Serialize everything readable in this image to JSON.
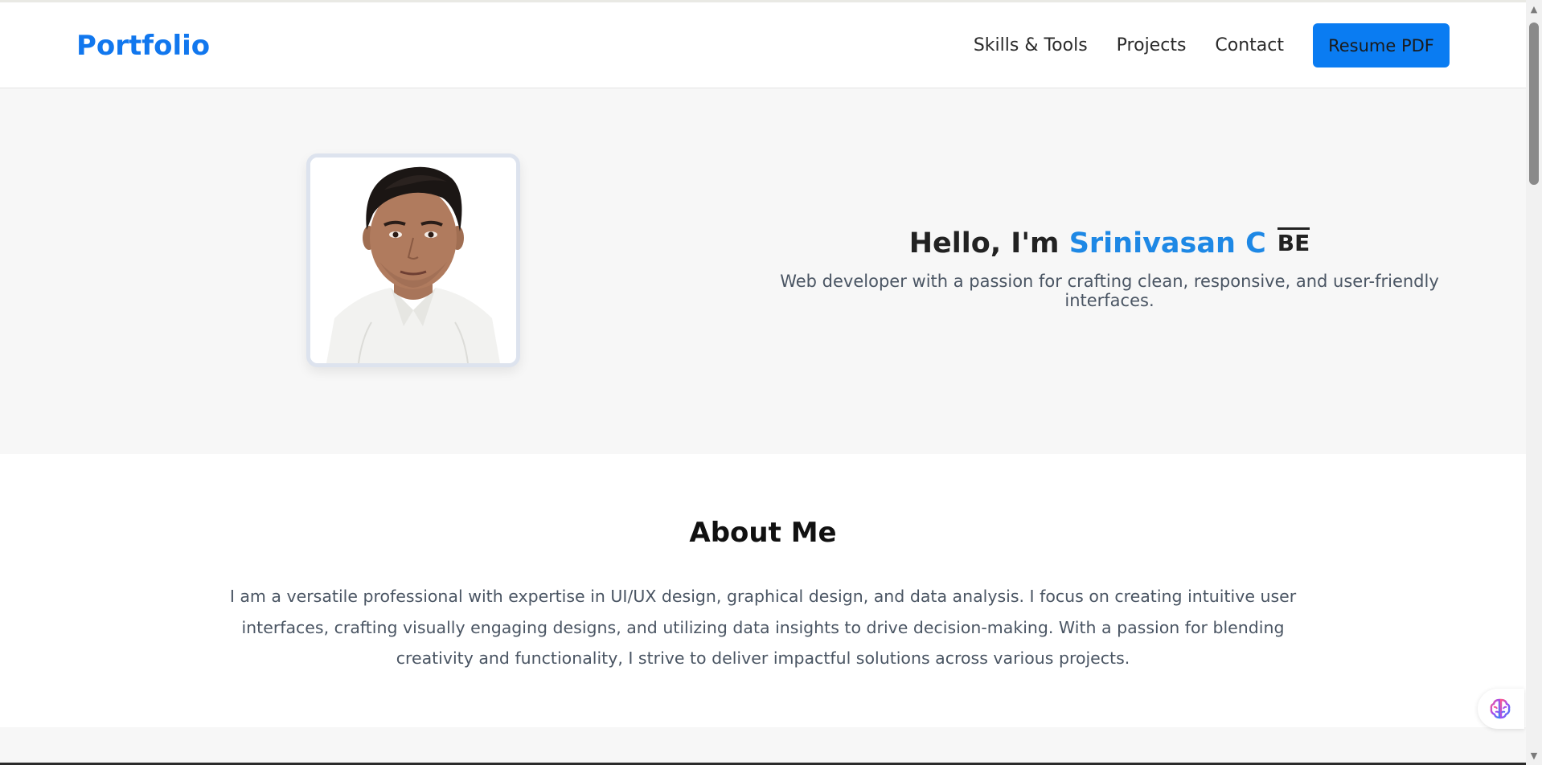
{
  "navbar": {
    "brand": "Portfolio",
    "links": [
      "Skills & Tools",
      "Projects",
      "Contact"
    ],
    "resume_button": "Resume PDF"
  },
  "hero": {
    "greeting": "Hello, I'm ",
    "name": "Srinivasan C",
    "degree": "BE",
    "subtitle": "Web developer with a passion for crafting clean, responsive, and user-friendly interfaces."
  },
  "about": {
    "title": "About Me",
    "text": "I am a versatile professional with expertise in UI/UX design, graphical design, and data analysis. I focus on creating intuitive user interfaces, crafting visually engaging designs, and utilizing data insights to drive decision-making. With a passion for blending creativity and functionality, I strive to deliver impactful solutions across various projects."
  },
  "icons": {
    "assistant": "brain-icon",
    "scroll_up": "arrow-up-icon",
    "scroll_down": "arrow-down-icon"
  },
  "colors": {
    "brand": "#1177ee",
    "accent_button": "#0a7cf2",
    "name_highlight": "#1e88e5",
    "hero_background": "#f7f7f7",
    "body_text": "#4a5563"
  }
}
